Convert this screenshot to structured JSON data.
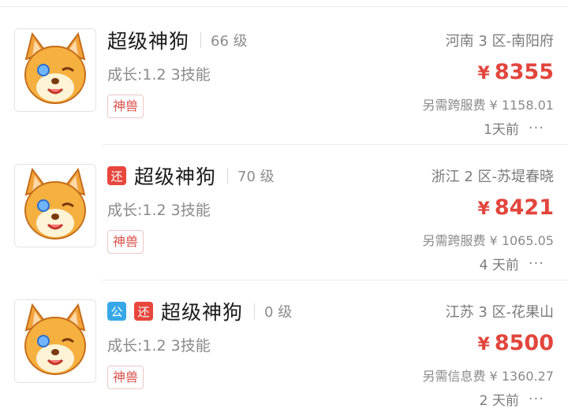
{
  "listings": [
    {
      "name": "超级神狗",
      "level": "66 级",
      "tags": [],
      "stats": "成长:1.2  3技能",
      "badge": "神兽",
      "server": "河南 3 区-南阳府",
      "currency": "¥",
      "price": "8355",
      "extra_fee": "另需跨服费 ¥ 1158.01",
      "time": "1天前",
      "more": "···"
    },
    {
      "name": "超级神狗",
      "level": "70 级",
      "tags": [
        "还"
      ],
      "stats": "成长:1.2  3技能",
      "badge": "神兽",
      "server": "浙江 2 区-苏堤春晓",
      "currency": "¥",
      "price": "8421",
      "extra_fee": "另需跨服费 ¥ 1065.05",
      "time": "4 天前",
      "more": "···"
    },
    {
      "name": "超级神狗",
      "level": "0 级",
      "tags": [
        "公",
        "还"
      ],
      "stats": "成长:1.2  3技能",
      "badge": "神兽",
      "server": "江苏 3 区-花果山",
      "currency": "¥",
      "price": "8500",
      "extra_fee": "另需信息费 ¥ 1360.27",
      "time": "2 天前",
      "more": "···"
    }
  ],
  "colors": {
    "price": "#e2453c",
    "badge_text": "#d9534f",
    "tag_gong": "#36a8e8",
    "tag_huan": "#e8473d"
  },
  "icons": {
    "avatar": "shiba-dog-pet-icon",
    "more": "more-dots-icon"
  }
}
